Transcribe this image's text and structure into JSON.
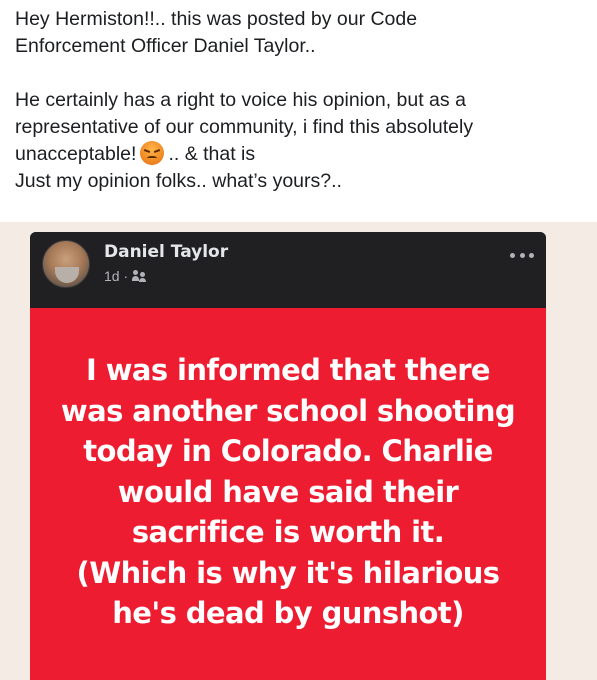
{
  "post": {
    "lines": [
      "Hey Hermiston!!.. this was posted by our Code",
      "Enforcement Officer Daniel Taylor..",
      "He certainly has a right to voice his opinion, but as a",
      "representative of our community, i find this absolutely",
      "unacceptable!",
      ".. & that is",
      "Just my opinion folks.. what’s yours?.."
    ],
    "emoji": "angry-face-emoji"
  },
  "shared": {
    "author": "Daniel Taylor",
    "time": "1d ·",
    "audience_icon": "friends-icon",
    "more_icon": "more-options-icon",
    "background_color": "#ee1c30",
    "text_lines": [
      "I was informed that there",
      "was another school shooting",
      "today in Colorado. Charlie",
      "would have said their",
      "sacrifice is worth it.",
      "(Which is why it's hilarious",
      "he's dead by gunshot)"
    ]
  }
}
